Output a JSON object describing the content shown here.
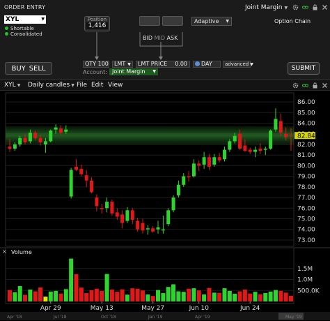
{
  "order_entry": {
    "title": "ORDER ENTRY",
    "account_selector": "Joint Margin",
    "symbol": "XYL",
    "flags": [
      "Shortable",
      "Consolidated"
    ],
    "position_label": "Position",
    "position_value": "1,416",
    "bid_label": "BID",
    "mid_label": "MID",
    "ask_label": "ASK",
    "algo": "Adaptive",
    "option_chain": "Option Chain",
    "buy_label": "BUY",
    "sell_label": "SELL",
    "qty": "QTY 100",
    "order_type": "LMT",
    "lmt_price_label": "LMT PRICE",
    "lmt_price_value": "0.00",
    "tif": "DAY",
    "advanced": "advanced",
    "account_label": "Account:",
    "account_value": "Joint Margin",
    "submit": "SUBMIT"
  },
  "chart_toolbar": {
    "symbol": "XYL",
    "period": "Daily candles",
    "menu": [
      "File",
      "Edit",
      "View"
    ]
  },
  "chart_data": {
    "type": "candlestick",
    "price_axis": [
      "86.00",
      "85.00",
      "84.00",
      "83.00",
      "82.00",
      "81.00",
      "80.00",
      "79.00",
      "78.00",
      "77.00",
      "76.00",
      "75.00",
      "74.00",
      "73.00"
    ],
    "current_price": "82.84",
    "ylim": [
      72.8,
      86.4
    ],
    "x_labels": [
      "Apr 29",
      "May 13",
      "May 27",
      "Jun 10",
      "Jun 24"
    ],
    "x_label_index": [
      8,
      18,
      28,
      37,
      47
    ],
    "timeline_labels": [
      "Apr '18",
      "Jul '18",
      "Oct '18",
      "Jan '19",
      "Apr '19",
      "May '19"
    ],
    "volume_label": "Volume",
    "volume_axis": [
      "1.5M",
      "1.0M",
      "500.0K"
    ],
    "volume_ylim": [
      0,
      2000000
    ],
    "candles": [
      {
        "o": 81.8,
        "h": 82.5,
        "l": 81.3,
        "c": 81.6
      },
      {
        "o": 81.6,
        "h": 82.2,
        "l": 81.4,
        "c": 82.0
      },
      {
        "o": 82.0,
        "h": 82.8,
        "l": 81.8,
        "c": 82.6
      },
      {
        "o": 82.6,
        "h": 83.0,
        "l": 82.0,
        "c": 82.2
      },
      {
        "o": 82.3,
        "h": 83.4,
        "l": 82.1,
        "c": 83.1
      },
      {
        "o": 83.1,
        "h": 83.3,
        "l": 82.4,
        "c": 82.6
      },
      {
        "o": 82.6,
        "h": 82.9,
        "l": 81.9,
        "c": 82.2
      },
      {
        "o": 82.0,
        "h": 82.6,
        "l": 81.2,
        "c": 82.3
      },
      {
        "o": 82.3,
        "h": 83.4,
        "l": 82.2,
        "c": 83.3
      },
      {
        "o": 83.4,
        "h": 83.9,
        "l": 83.0,
        "c": 83.6
      },
      {
        "o": 83.5,
        "h": 83.8,
        "l": 82.9,
        "c": 83.1
      },
      {
        "o": 83.2,
        "h": 83.8,
        "l": 83.0,
        "c": 83.4
      },
      {
        "o": 77.1,
        "h": 79.8,
        "l": 76.9,
        "c": 79.6
      },
      {
        "o": 79.9,
        "h": 80.6,
        "l": 79.5,
        "c": 79.6
      },
      {
        "o": 79.7,
        "h": 80.1,
        "l": 79.0,
        "c": 79.2
      },
      {
        "o": 79.1,
        "h": 79.6,
        "l": 78.0,
        "c": 78.6
      },
      {
        "o": 78.6,
        "h": 78.9,
        "l": 77.4,
        "c": 77.5
      },
      {
        "o": 77.0,
        "h": 77.3,
        "l": 75.7,
        "c": 76.2
      },
      {
        "o": 76.0,
        "h": 76.4,
        "l": 75.5,
        "c": 75.9
      },
      {
        "o": 76.0,
        "h": 77.0,
        "l": 75.6,
        "c": 76.6
      },
      {
        "o": 76.6,
        "h": 76.8,
        "l": 75.3,
        "c": 75.5
      },
      {
        "o": 75.6,
        "h": 76.0,
        "l": 74.9,
        "c": 75.2
      },
      {
        "o": 75.4,
        "h": 75.8,
        "l": 74.1,
        "c": 74.6
      },
      {
        "o": 74.8,
        "h": 76.1,
        "l": 74.6,
        "c": 75.8
      },
      {
        "o": 75.8,
        "h": 76.0,
        "l": 74.5,
        "c": 74.9
      },
      {
        "o": 74.8,
        "h": 75.1,
        "l": 73.8,
        "c": 74.0
      },
      {
        "o": 74.6,
        "h": 75.0,
        "l": 73.6,
        "c": 73.9
      },
      {
        "o": 74.0,
        "h": 74.4,
        "l": 73.5,
        "c": 74.1
      },
      {
        "o": 74.1,
        "h": 74.3,
        "l": 73.7,
        "c": 73.8
      },
      {
        "o": 74.0,
        "h": 74.8,
        "l": 73.6,
        "c": 74.2
      },
      {
        "o": 73.9,
        "h": 75.3,
        "l": 73.6,
        "c": 74.0
      },
      {
        "o": 74.5,
        "h": 76.0,
        "l": 74.3,
        "c": 75.8
      },
      {
        "o": 75.8,
        "h": 77.2,
        "l": 75.6,
        "c": 77.0
      },
      {
        "o": 77.2,
        "h": 78.6,
        "l": 77.0,
        "c": 78.2
      },
      {
        "o": 78.2,
        "h": 79.3,
        "l": 78.0,
        "c": 79.0
      },
      {
        "o": 79.0,
        "h": 79.5,
        "l": 78.5,
        "c": 78.9
      },
      {
        "o": 79.0,
        "h": 80.6,
        "l": 78.9,
        "c": 80.2
      },
      {
        "o": 80.2,
        "h": 80.5,
        "l": 79.5,
        "c": 80.0
      },
      {
        "o": 80.1,
        "h": 81.3,
        "l": 79.7,
        "c": 80.8
      },
      {
        "o": 80.8,
        "h": 81.1,
        "l": 79.6,
        "c": 79.9
      },
      {
        "o": 80.1,
        "h": 81.1,
        "l": 79.9,
        "c": 80.8
      },
      {
        "o": 80.8,
        "h": 81.2,
        "l": 80.3,
        "c": 80.5
      },
      {
        "o": 80.6,
        "h": 81.8,
        "l": 80.4,
        "c": 81.5
      },
      {
        "o": 81.5,
        "h": 82.5,
        "l": 81.3,
        "c": 82.3
      },
      {
        "o": 82.3,
        "h": 83.1,
        "l": 82.1,
        "c": 82.8
      },
      {
        "o": 83.0,
        "h": 83.4,
        "l": 81.5,
        "c": 81.6
      },
      {
        "o": 81.9,
        "h": 82.5,
        "l": 81.3,
        "c": 81.4
      },
      {
        "o": 81.5,
        "h": 81.7,
        "l": 81.1,
        "c": 81.3
      },
      {
        "o": 81.3,
        "h": 81.8,
        "l": 80.8,
        "c": 81.5
      },
      {
        "o": 81.6,
        "h": 82.1,
        "l": 81.1,
        "c": 81.4
      },
      {
        "o": 81.5,
        "h": 81.8,
        "l": 81.0,
        "c": 81.6
      },
      {
        "o": 81.6,
        "h": 83.4,
        "l": 81.5,
        "c": 83.3
      },
      {
        "o": 83.4,
        "h": 85.4,
        "l": 83.2,
        "c": 84.4
      },
      {
        "o": 84.2,
        "h": 84.9,
        "l": 82.8,
        "c": 83.1
      },
      {
        "o": 83.0,
        "h": 83.6,
        "l": 82.4,
        "c": 82.7
      },
      {
        "o": 82.9,
        "h": 83.5,
        "l": 81.4,
        "c": 82.84
      }
    ],
    "volume": [
      520000,
      420000,
      700000,
      300000,
      540000,
      460000,
      640000,
      220000,
      450000,
      480000,
      360000,
      560000,
      1950000,
      1240000,
      630000,
      380000,
      510000,
      580000,
      480000,
      1250000,
      540000,
      440000,
      550000,
      310000,
      600000,
      580000,
      500000,
      320000,
      250000,
      520000,
      380000,
      660000,
      780000,
      460000,
      440000,
      580000,
      600000,
      500000,
      320000,
      610000,
      400000,
      390000,
      600000,
      480000,
      350000,
      460000,
      540000,
      360000,
      440000,
      330000,
      380000,
      450000,
      520000,
      480000,
      400000,
      260000
    ],
    "volume_highlight_index": 7
  }
}
